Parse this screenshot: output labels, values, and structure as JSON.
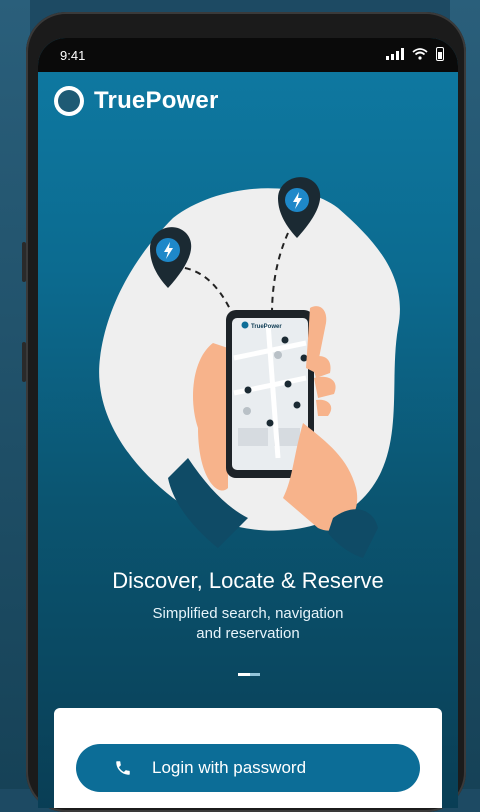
{
  "status_bar": {
    "time": "9:41"
  },
  "brand": {
    "name": "TruePower"
  },
  "onboarding": {
    "title": "Discover, Locate & Reserve",
    "subtitle_line1": "Simplified search, navigation",
    "subtitle_line2": "and reservation",
    "pager": {
      "current": 1,
      "total": 2
    }
  },
  "illustration": {
    "mini_brand": "TruePower"
  },
  "actions": {
    "login_label": "Login with password"
  },
  "icons": {
    "logo": "truepower-logo-icon",
    "signal": "cellular-signal-icon",
    "wifi": "wifi-icon",
    "battery": "battery-icon",
    "charger_pin": "charging-pin-icon",
    "phone": "phone-icon"
  },
  "colors": {
    "primary": "#0c6d97",
    "gradient_top": "#0e7aa3",
    "gradient_bottom": "#093e55",
    "blob": "#efefef",
    "pin": "#1b2a33",
    "pin_accent": "#1e88c9",
    "skin": "#f7b38b"
  }
}
